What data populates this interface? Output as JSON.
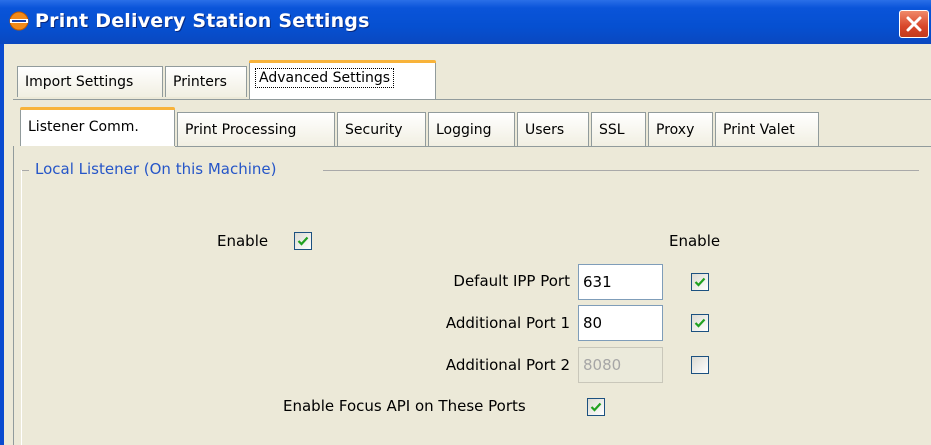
{
  "window": {
    "title": "Print Delivery Station Settings",
    "icon": "app-globe-icon",
    "close_icon": "close-icon"
  },
  "top_tabs": [
    {
      "label": "Import Settings",
      "selected": false
    },
    {
      "label": "Printers",
      "selected": false
    },
    {
      "label": "Advanced Settings",
      "selected": true
    }
  ],
  "sub_tabs": [
    {
      "label": "Listener Comm.",
      "selected": true
    },
    {
      "label": "Print Processing",
      "selected": false
    },
    {
      "label": "Security",
      "selected": false
    },
    {
      "label": "Logging",
      "selected": false
    },
    {
      "label": "Users",
      "selected": false
    },
    {
      "label": "SSL",
      "selected": false
    },
    {
      "label": "Proxy",
      "selected": false
    },
    {
      "label": "Print Valet",
      "selected": false
    }
  ],
  "group": {
    "title": "Local Listener (On this Machine)",
    "enable_label": "Enable",
    "enable_checked": true,
    "column_header": "Enable",
    "ports": [
      {
        "label": "Default IPP Port",
        "value": "631",
        "enabled_field": true,
        "checked": true
      },
      {
        "label": "Additional Port 1",
        "value": "80",
        "enabled_field": true,
        "checked": true
      },
      {
        "label": "Additional Port 2",
        "value": "8080",
        "enabled_field": false,
        "checked": false
      }
    ],
    "focus_api_label": "Enable Focus API on These Ports",
    "focus_api_checked": true
  },
  "colors": {
    "titlebar": "#0650d1",
    "group_title": "#2656c8",
    "selected_tab_accent": "#f8b33a",
    "check": "#21a121"
  }
}
